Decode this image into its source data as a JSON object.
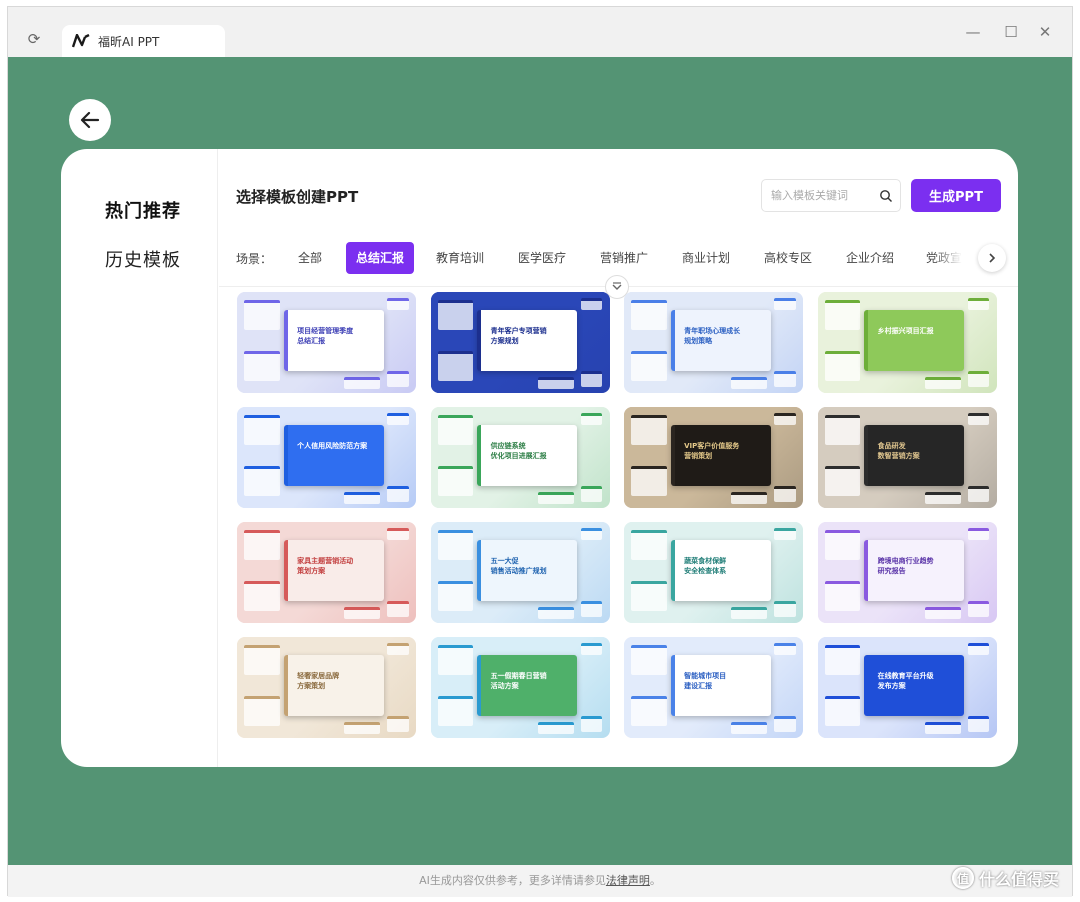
{
  "tab": {
    "title": "福昕AI PPT"
  },
  "sidebar": {
    "items": [
      {
        "label": "热门推荐"
      },
      {
        "label": "历史模板"
      }
    ]
  },
  "main": {
    "title": "选择模板创建PPT",
    "search_placeholder": "输入模板关键词",
    "generate_label": "生成PPT"
  },
  "scenes": {
    "label": "场景：",
    "tabs": [
      "全部",
      "总结汇报",
      "教育培训",
      "医学医疗",
      "营销推广",
      "商业计划",
      "高校专区",
      "企业介绍",
      "党政宣传"
    ],
    "active": "总结汇报"
  },
  "templates": [
    {
      "theme": "#6f66e8",
      "bg": "#dfe3f7",
      "slide": "#ffffff",
      "text": "项目经营管理季度\n总结汇报",
      "text_color": "#3d3fb5"
    },
    {
      "theme": "#1c2f8e",
      "bg": "#2a47b8",
      "slide": "#ffffff",
      "text": "青年客户专项营销\n方案规划",
      "text_color": "#1c2f8e"
    },
    {
      "theme": "#4a7fe8",
      "bg": "#e1e9f8",
      "slide": "#eef3fd",
      "text": "青年职场心理成长\n规划策略",
      "text_color": "#2b5fc2"
    },
    {
      "theme": "#6dae3a",
      "bg": "#e9f2dc",
      "slide": "#8ec95a",
      "text": "乡村振兴项目汇报",
      "text_color": "#ffffff"
    },
    {
      "theme": "#1f5fe0",
      "bg": "#dce6fb",
      "slide": "#2f6ef0",
      "text": "个人信用风险防范方案",
      "text_color": "#ffffff"
    },
    {
      "theme": "#3aa65a",
      "bg": "#e2f2e6",
      "slide": "#ffffff",
      "text": "供应链系统\n优化项目进展汇报",
      "text_color": "#2b7d44"
    },
    {
      "theme": "#2a2520",
      "bg": "#cbb89a",
      "slide": "#1f1b17",
      "text": "VIP客户价值服务\n营销策划",
      "text_color": "#e4c98a"
    },
    {
      "theme": "#2d2d2d",
      "bg": "#d5ccbf",
      "slide": "#262626",
      "text": "食品研发\n数智营销方案",
      "text_color": "#e0c68f"
    },
    {
      "theme": "#d65a5a",
      "bg": "#f4d9d6",
      "slide": "#f9ece9",
      "text": "家具主题营销活动\n策划方案",
      "text_color": "#c23d3d"
    },
    {
      "theme": "#3a8fe0",
      "bg": "#dcecf8",
      "slide": "#eef6fd",
      "text": "五一大促\n销售活动推广规划",
      "text_color": "#1f63b0"
    },
    {
      "theme": "#3aa6a0",
      "bg": "#dff1ef",
      "slide": "#ffffff",
      "text": "蔬菜食材保鲜\n安全检查体系",
      "text_color": "#1f7d77"
    },
    {
      "theme": "#8a5ae0",
      "bg": "#ebe3f8",
      "slide": "#f6f2fd",
      "text": "跨境电商行业趋势\n研究报告",
      "text_color": "#5a34a8"
    },
    {
      "theme": "#c4a272",
      "bg": "#f1e7d8",
      "slide": "#f8f2e9",
      "text": "轻奢家居品牌\n方案策划",
      "text_color": "#8a6a3e"
    },
    {
      "theme": "#2a9ad0",
      "bg": "#d8eef8",
      "slide": "#4fb06a",
      "text": "五一假期春日营销\n活动方案",
      "text_color": "#ffffff"
    },
    {
      "theme": "#4a82e8",
      "bg": "#e2ebfb",
      "slide": "#ffffff",
      "text": "智能城市项目\n建设汇报",
      "text_color": "#2b5fc2"
    },
    {
      "theme": "#1f4fd8",
      "bg": "#dbe4fb",
      "slide": "#1f4fd8",
      "text": "在线教育平台升级\n发布方案",
      "text_color": "#ffffff"
    }
  ],
  "footer": {
    "text": "AI生成内容仅供参考，更多详情请参见",
    "link": "法律声明",
    "end": "。"
  },
  "watermark": {
    "circle": "值",
    "text": "什么值得买"
  }
}
